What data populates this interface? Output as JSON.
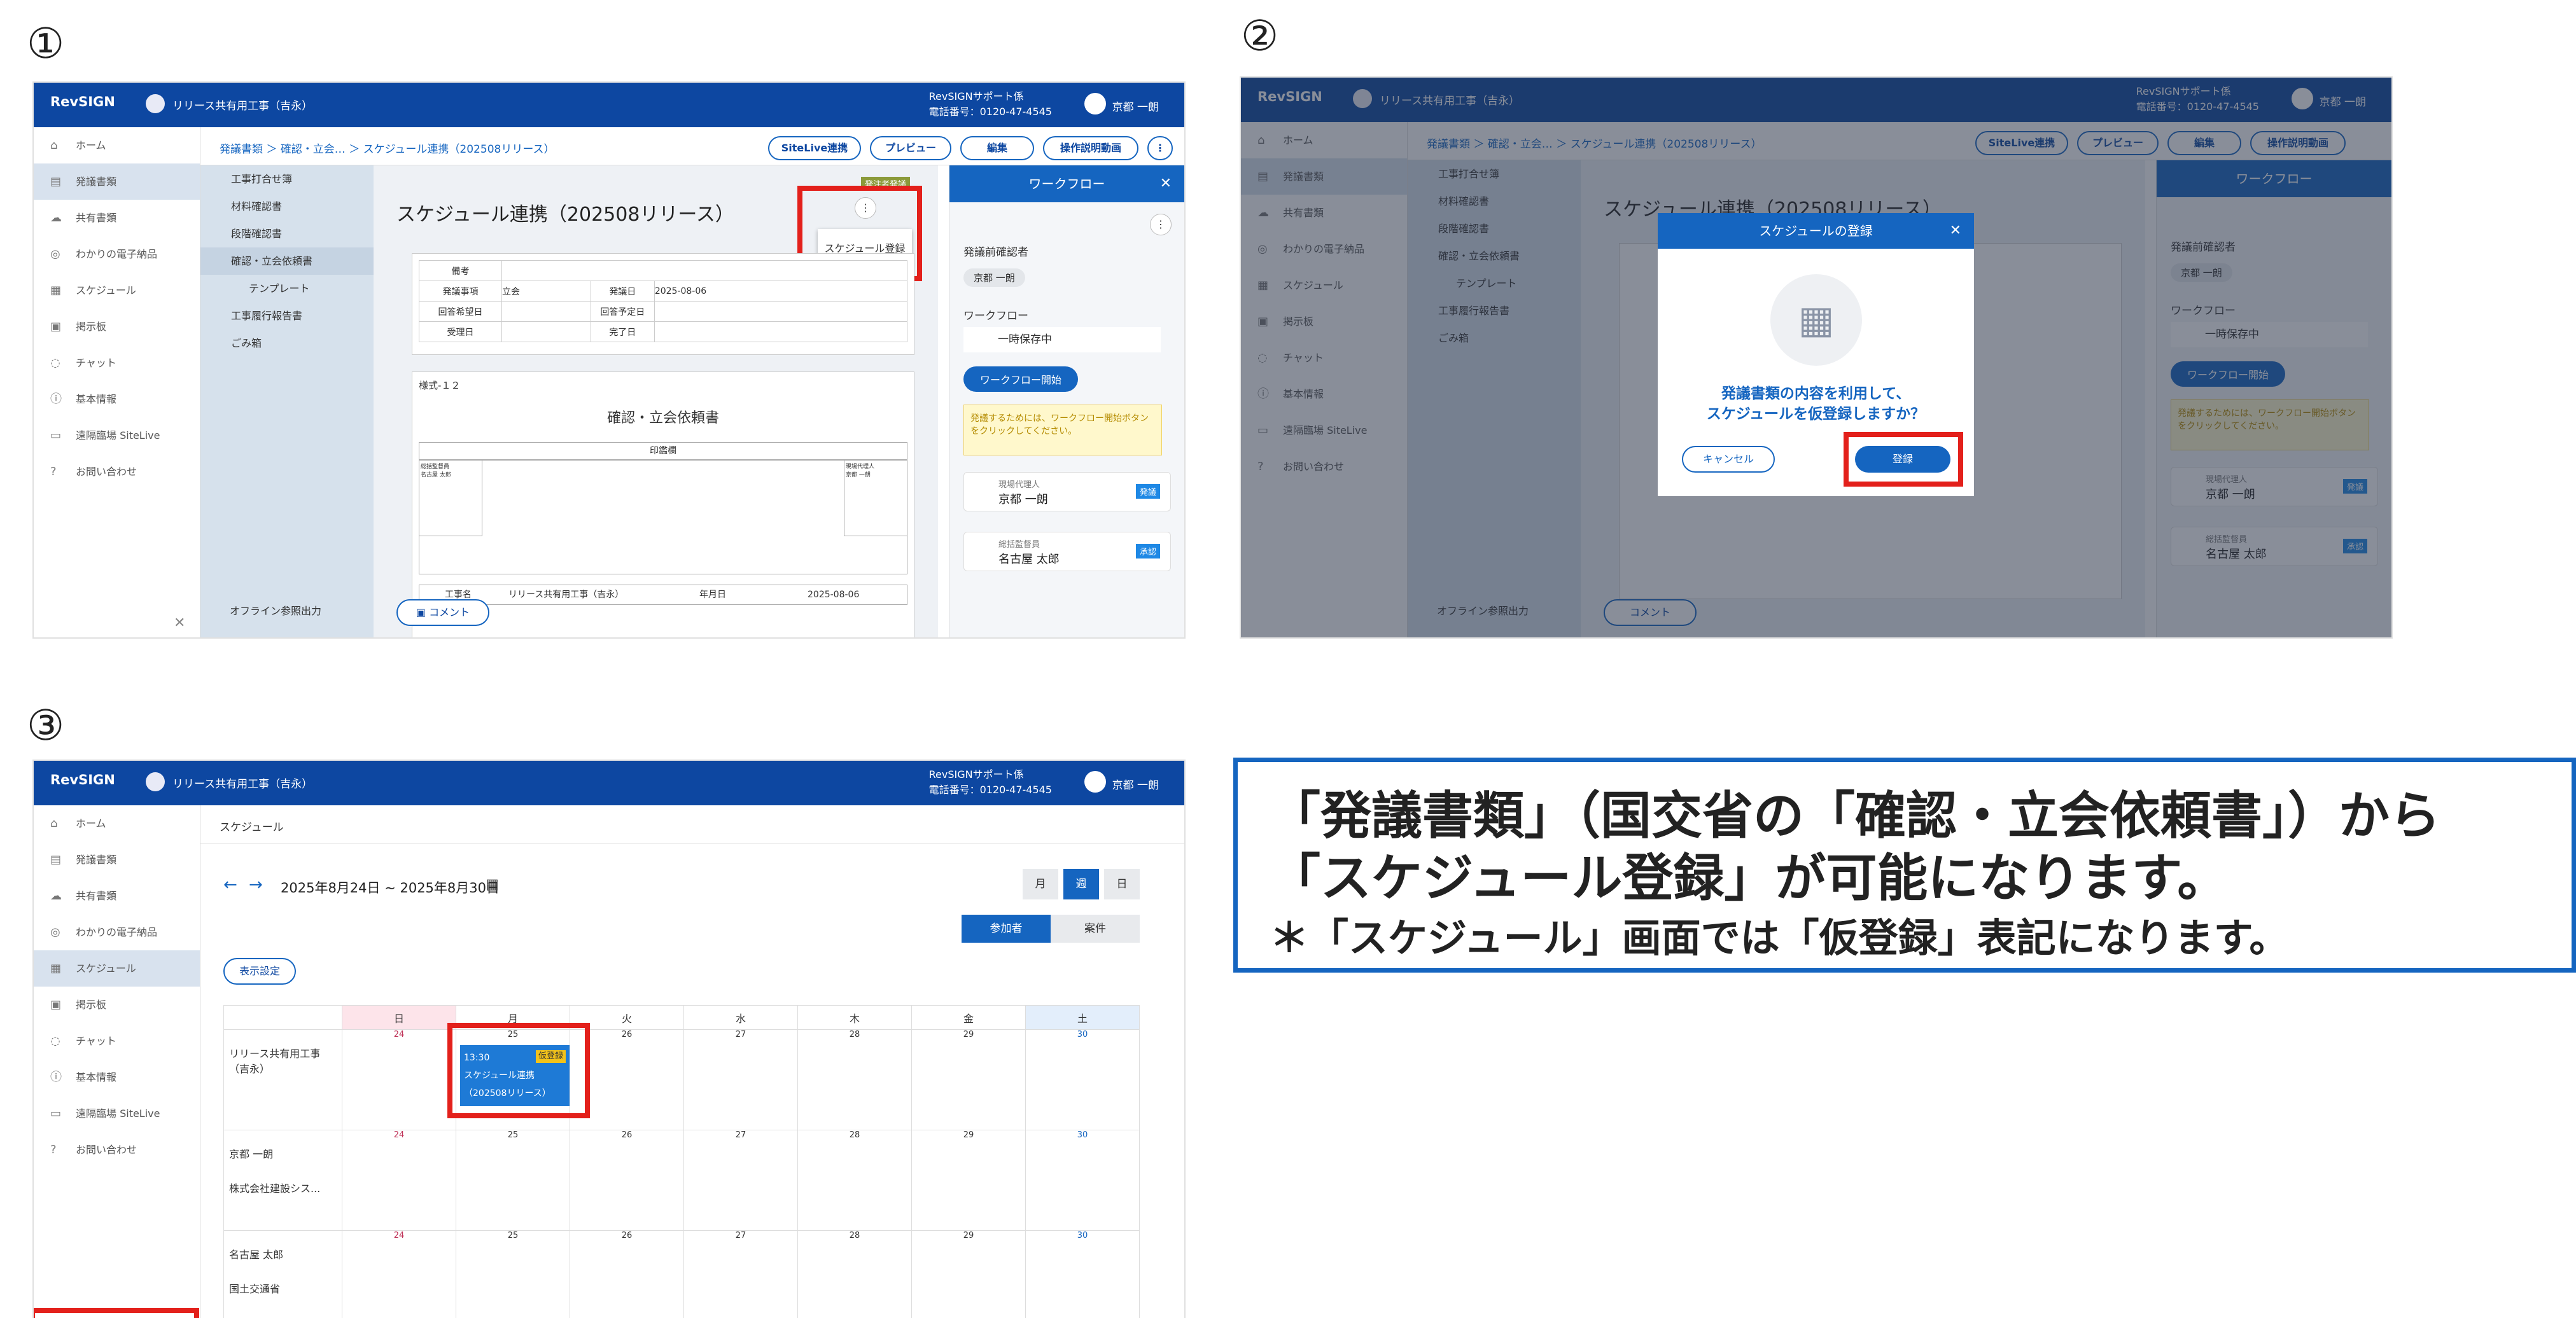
{
  "markers": [
    "①",
    "②",
    "③"
  ],
  "app": {
    "logo": "RevSIGN",
    "project": "リリース共有用工事（吉永）",
    "support_name": "RevSIGNサポート係",
    "support_phone": "電話番号：0120-47-4545",
    "user": "京都 一朗"
  },
  "nav": [
    "ホーム",
    "発議書類",
    "共有書類",
    "わかりの電子納品",
    "スケジュール",
    "掲示板",
    "チャット",
    "基本情報",
    "遠隔臨場 SiteLive",
    "お問い合わせ"
  ],
  "panel1": {
    "breadcrumb": "発議書類 ＞ 確認・立会… ＞ スケジュール連携（202508リリース）",
    "buttons": [
      "SiteLive連携",
      "プレビュー",
      "編集",
      "操作説明動画"
    ],
    "tree": [
      "工事打合せ簿",
      "材料確認書",
      "段階確認書",
      "確認・立会依頼書",
      "テンプレート",
      "工事履行報告書",
      "ごみ箱"
    ],
    "offline": "オフライン参照出力",
    "status_badge": "発注者発議",
    "doc_title": "スケジュール連携（202508リリース）",
    "menu_item": "スケジュール登録",
    "table": {
      "remarks": "備考",
      "item": "発議事項",
      "item_value": "立会",
      "date": "発議日",
      "date_value": "2025-08-06",
      "reply_wish": "回答希望日",
      "reply_plan": "回答予定日",
      "receive": "受理日",
      "done": "完了日"
    },
    "form_no": "様式-１２",
    "form_title": "確認・立会依頼書",
    "seal": "印鑑欄",
    "supervisor": "総括監督員\n名古屋 太郎",
    "agent": "現場代理人\n京都 一朗",
    "work_name": "工事名",
    "work_name_value": "リリース共有用工事（吉永）",
    "ymd": "年月日",
    "ymd_value": "2025-08-06",
    "comment": "コメント",
    "wf": {
      "title": "ワークフロー",
      "approver_label": "発議前確認者",
      "approver": "京都 一朗",
      "wf_label": "ワークフロー",
      "saved": "一時保存中",
      "start": "ワークフロー開始",
      "notice": "発議するためには、ワークフロー開始ボタンをクリックしてください。",
      "card1_role": "現場代理人",
      "card1_name": "京都 一朗",
      "card1_badge": "発議",
      "card2_role": "総括監督員",
      "card2_name": "名古屋 太郎",
      "card2_badge": "承認"
    }
  },
  "panel2": {
    "dialog_title": "スケジュールの登録",
    "message_line1": "発議書類の内容を利用して、",
    "message_line2": "スケジュールを仮登録しますか？",
    "cancel": "キャンセル",
    "register": "登録"
  },
  "panel3": {
    "breadcrumb": "スケジュール",
    "range": "2025年8月24日 ~ 2025年8月30日",
    "views": [
      "月",
      "週",
      "日"
    ],
    "modes": [
      "参加者",
      "案件"
    ],
    "display_settings": "表示設定",
    "weekdays": [
      "日",
      "月",
      "火",
      "水",
      "木",
      "金",
      "土"
    ],
    "dates": [
      "24",
      "25",
      "26",
      "27",
      "28",
      "29",
      "30"
    ],
    "rows": [
      {
        "name": "リリース共有用工事（吉永）",
        "sub": ""
      },
      {
        "name": "京都 一朗",
        "sub": "株式会社建設シス..."
      },
      {
        "name": "名古屋 太郎",
        "sub": "国土交通省"
      }
    ],
    "event_time": "13:30",
    "event_badge": "仮登録",
    "event_title": "スケジュール連携（202508リリース）"
  },
  "callout": {
    "line1": "「発議書類」（国交省の「確認・立会依頼書」）から",
    "line2": "「スケジュール登録」が可能になります。",
    "line3": "＊「スケジュール」画面では「仮登録」表記になります。"
  },
  "colors": {
    "brand": "#0d47a1",
    "accent": "#1565c0",
    "highlight": "#e3201b",
    "event": "#1e7ad6",
    "badge": "#f2c21a"
  }
}
